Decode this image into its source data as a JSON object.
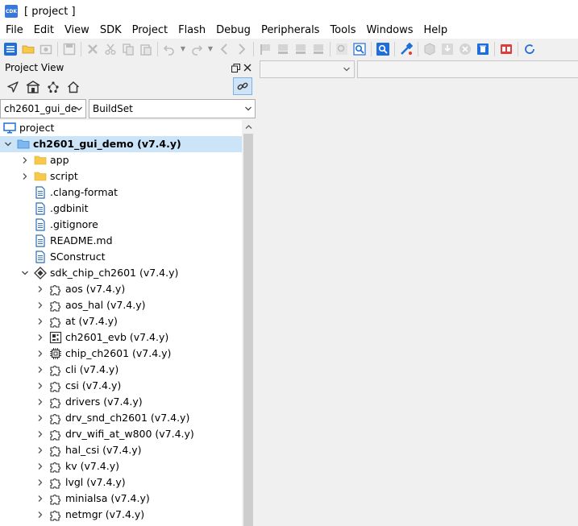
{
  "window": {
    "title": "[ project ]",
    "app_icon": "CDK"
  },
  "menu": [
    "File",
    "Edit",
    "View",
    "SDK",
    "Project",
    "Flash",
    "Debug",
    "Peripherals",
    "Tools",
    "Windows",
    "Help"
  ],
  "project_view": {
    "title": "Project View",
    "solution_select": "ch2601_gui_de",
    "buildset_select": "BuildSet",
    "tree": [
      {
        "label": "project",
        "icon": "monitor-icon",
        "level": 0,
        "expander": "none"
      },
      {
        "label": "ch2601_gui_demo (v7.4.y)",
        "icon": "folder-blue-icon",
        "level": 0,
        "expander": "expanded",
        "selected": true,
        "bold": true
      },
      {
        "label": "app",
        "icon": "folder-icon",
        "level": 1,
        "expander": "collapsed"
      },
      {
        "label": "script",
        "icon": "folder-icon",
        "level": 1,
        "expander": "collapsed"
      },
      {
        "label": ".clang-format",
        "icon": "file-icon",
        "level": 1,
        "expander": "none"
      },
      {
        "label": ".gdbinit",
        "icon": "file-icon",
        "level": 1,
        "expander": "none"
      },
      {
        "label": ".gitignore",
        "icon": "file-icon",
        "level": 1,
        "expander": "none"
      },
      {
        "label": "README.md",
        "icon": "file-icon",
        "level": 1,
        "expander": "none"
      },
      {
        "label": "SConstruct",
        "icon": "file-icon",
        "level": 1,
        "expander": "none"
      },
      {
        "label": "sdk_chip_ch2601 (v7.4.y)",
        "icon": "sdk-icon",
        "level": 1,
        "expander": "expanded"
      },
      {
        "label": "aos (v7.4.y)",
        "icon": "component-icon",
        "level": 2,
        "expander": "collapsed"
      },
      {
        "label": "aos_hal (v7.4.y)",
        "icon": "component-icon",
        "level": 2,
        "expander": "collapsed"
      },
      {
        "label": "at (v7.4.y)",
        "icon": "component-icon",
        "level": 2,
        "expander": "collapsed"
      },
      {
        "label": "ch2601_evb (v7.4.y)",
        "icon": "board-icon",
        "level": 2,
        "expander": "collapsed"
      },
      {
        "label": "chip_ch2601 (v7.4.y)",
        "icon": "chip-icon",
        "level": 2,
        "expander": "collapsed"
      },
      {
        "label": "cli (v7.4.y)",
        "icon": "component-icon",
        "level": 2,
        "expander": "collapsed"
      },
      {
        "label": "csi (v7.4.y)",
        "icon": "component-icon",
        "level": 2,
        "expander": "collapsed"
      },
      {
        "label": "drivers (v7.4.y)",
        "icon": "component-icon",
        "level": 2,
        "expander": "collapsed"
      },
      {
        "label": "drv_snd_ch2601 (v7.4.y)",
        "icon": "component-icon",
        "level": 2,
        "expander": "collapsed"
      },
      {
        "label": "drv_wifi_at_w800 (v7.4.y)",
        "icon": "component-icon",
        "level": 2,
        "expander": "collapsed"
      },
      {
        "label": "hal_csi (v7.4.y)",
        "icon": "component-icon",
        "level": 2,
        "expander": "collapsed"
      },
      {
        "label": "kv (v7.4.y)",
        "icon": "component-icon",
        "level": 2,
        "expander": "collapsed"
      },
      {
        "label": "lvgl (v7.4.y)",
        "icon": "component-icon",
        "level": 2,
        "expander": "collapsed"
      },
      {
        "label": "minialsa (v7.4.y)",
        "icon": "component-icon",
        "level": 2,
        "expander": "collapsed"
      },
      {
        "label": "netmgr (v7.4.y)",
        "icon": "component-icon",
        "level": 2,
        "expander": "collapsed"
      },
      {
        "label": "",
        "icon": "component-icon",
        "level": 2,
        "expander": "collapsed"
      }
    ]
  },
  "colors": {
    "selection": "#cce4f7",
    "accent": "#1e6fd9",
    "folder": "#f7c948"
  }
}
